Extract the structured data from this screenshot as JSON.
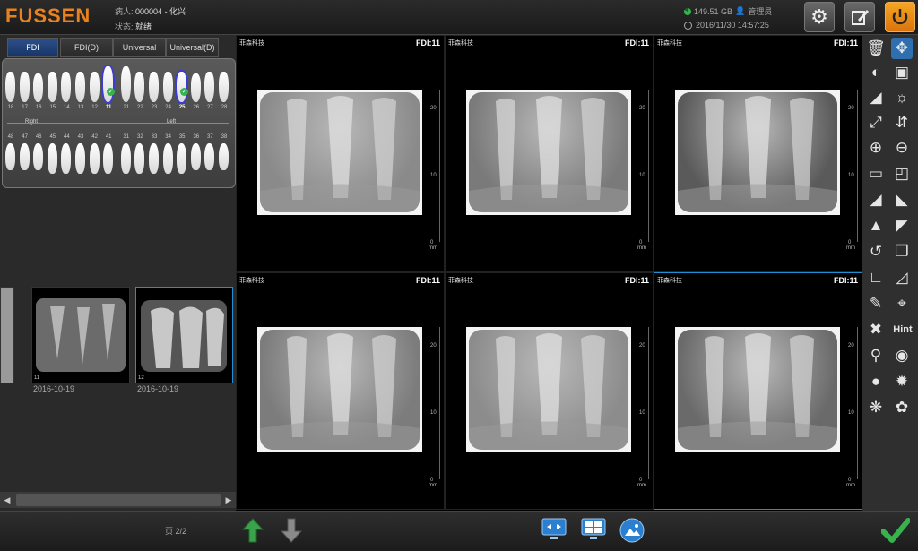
{
  "header": {
    "logo": "FUSSEN",
    "patient_label": "病人:",
    "patient_value": "000004 - 化兴",
    "status_label": "状态:",
    "status_value": "就绪",
    "disk": "149.51 GB",
    "user": "管理员",
    "datetime": "2016/11/30 14:57:25"
  },
  "tabs": [
    {
      "label": "FDI",
      "active": true
    },
    {
      "label": "FDI(D)",
      "active": false
    },
    {
      "label": "Universal",
      "active": false
    },
    {
      "label": "Universal(D)",
      "active": false
    }
  ],
  "tooth_chart": {
    "upper_numbers": [
      "18",
      "17",
      "16",
      "15",
      "14",
      "13",
      "12",
      "11",
      "21",
      "22",
      "23",
      "24",
      "25",
      "26",
      "27",
      "28"
    ],
    "lower_numbers": [
      "48",
      "47",
      "46",
      "45",
      "44",
      "43",
      "42",
      "41",
      "31",
      "32",
      "33",
      "34",
      "35",
      "36",
      "37",
      "38"
    ],
    "right_label": "Right",
    "left_label": "Left",
    "selected": [
      "11",
      "25"
    ]
  },
  "thumbnails": [
    {
      "index": "",
      "date": ""
    },
    {
      "index": "11",
      "date": "2016-10-19"
    },
    {
      "index": "12",
      "date": "2016-10-19"
    }
  ],
  "viewer": {
    "brand": "菲森科技",
    "cells": [
      {
        "fdi": "FDI:11"
      },
      {
        "fdi": "FDI:11"
      },
      {
        "fdi": "FDI:11"
      },
      {
        "fdi": "FDI:11"
      },
      {
        "fdi": "FDI:11"
      },
      {
        "fdi": "FDI:11"
      }
    ],
    "ruler_labels": [
      "20",
      "10",
      "0"
    ],
    "ruler_unit": "mm"
  },
  "toolbar": {
    "hint_label": "Hint"
  },
  "footer": {
    "page_label": "页",
    "page_value": "2/2"
  },
  "colors": {
    "logo": "#e8821e",
    "accent": "#1f8fd1",
    "confirm": "#37b24d",
    "nav_arrow": "#3aa24a"
  }
}
